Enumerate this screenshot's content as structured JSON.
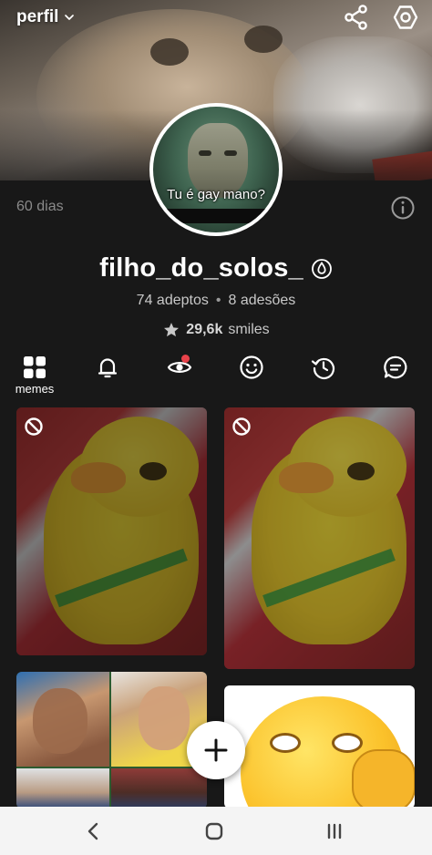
{
  "header": {
    "title": "perfil",
    "share_icon": "share-icon",
    "settings_icon": "settings-icon"
  },
  "avatar": {
    "caption": "Tu é gay mano?"
  },
  "profile": {
    "days": "60 dias",
    "username": "filho_do_solos_",
    "username_badge_icon": "drop-icon",
    "followers": "74 adeptos",
    "separator": "•",
    "following": "8 adesões",
    "smiles_value": "29,6k",
    "smiles_label": "smiles"
  },
  "tabs": [
    {
      "name": "memes",
      "label": "memes",
      "icon": "grid-icon",
      "active": true
    },
    {
      "name": "notifications",
      "label": "",
      "icon": "bell-icon",
      "active": false
    },
    {
      "name": "views",
      "label": "",
      "icon": "eye-icon",
      "active": false,
      "badge": true
    },
    {
      "name": "reactions",
      "label": "",
      "icon": "smile-icon",
      "active": false
    },
    {
      "name": "history",
      "label": "",
      "icon": "history-icon",
      "active": false
    },
    {
      "name": "comments",
      "label": "",
      "icon": "comment-icon",
      "active": false
    }
  ],
  "grid": {
    "items": [
      {
        "kind": "chick-meme",
        "blocked": true
      },
      {
        "kind": "chick-meme",
        "blocked": true
      },
      {
        "kind": "football-collage",
        "blocked": false
      },
      {
        "kind": "emoji-meme",
        "blocked": false
      }
    ]
  },
  "fab": {
    "icon": "plus-icon"
  },
  "navbar": {
    "back_icon": "back-icon",
    "home_icon": "home-icon",
    "recent_icon": "recent-apps-icon"
  },
  "colors": {
    "background": "#181818",
    "badge_red": "#e8424a",
    "muted_text": "#8a8a8a"
  }
}
